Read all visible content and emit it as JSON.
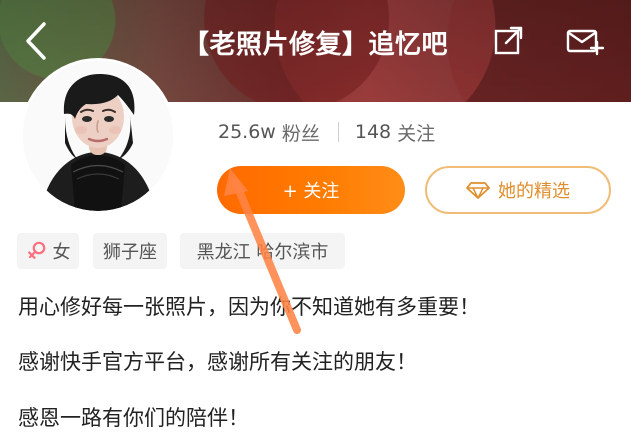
{
  "header": {
    "title": "【老照片修复】追忆吧"
  },
  "profile": {
    "stats": {
      "fans_value": "25.6w",
      "fans_label": "粉丝",
      "following_value": "148",
      "following_label": "关注"
    },
    "actions": {
      "follow_label": "+ 关注",
      "picks_label": "她的精选"
    },
    "tags": {
      "gender": "女",
      "zodiac": "狮子座",
      "location": "黑龙江 哈尔滨市"
    },
    "bio": [
      "用心修好每一张照片，因为你不知道她有多重要！",
      "感谢快手官方平台，感谢所有关注的朋友！",
      "感恩一路有你们的陪伴！"
    ]
  },
  "icons": {
    "back": "back-icon",
    "share": "share-icon",
    "mail": "mail-icon",
    "female": "female-icon",
    "picks": "diamond-icon",
    "annotation": "arrow-icon"
  },
  "colors": {
    "primary": "#ff7a00",
    "accent_border": "#efbd78",
    "accent_text": "#df8f2d",
    "tag_bg": "#f4f4f4",
    "female": "#ff6f7d"
  }
}
